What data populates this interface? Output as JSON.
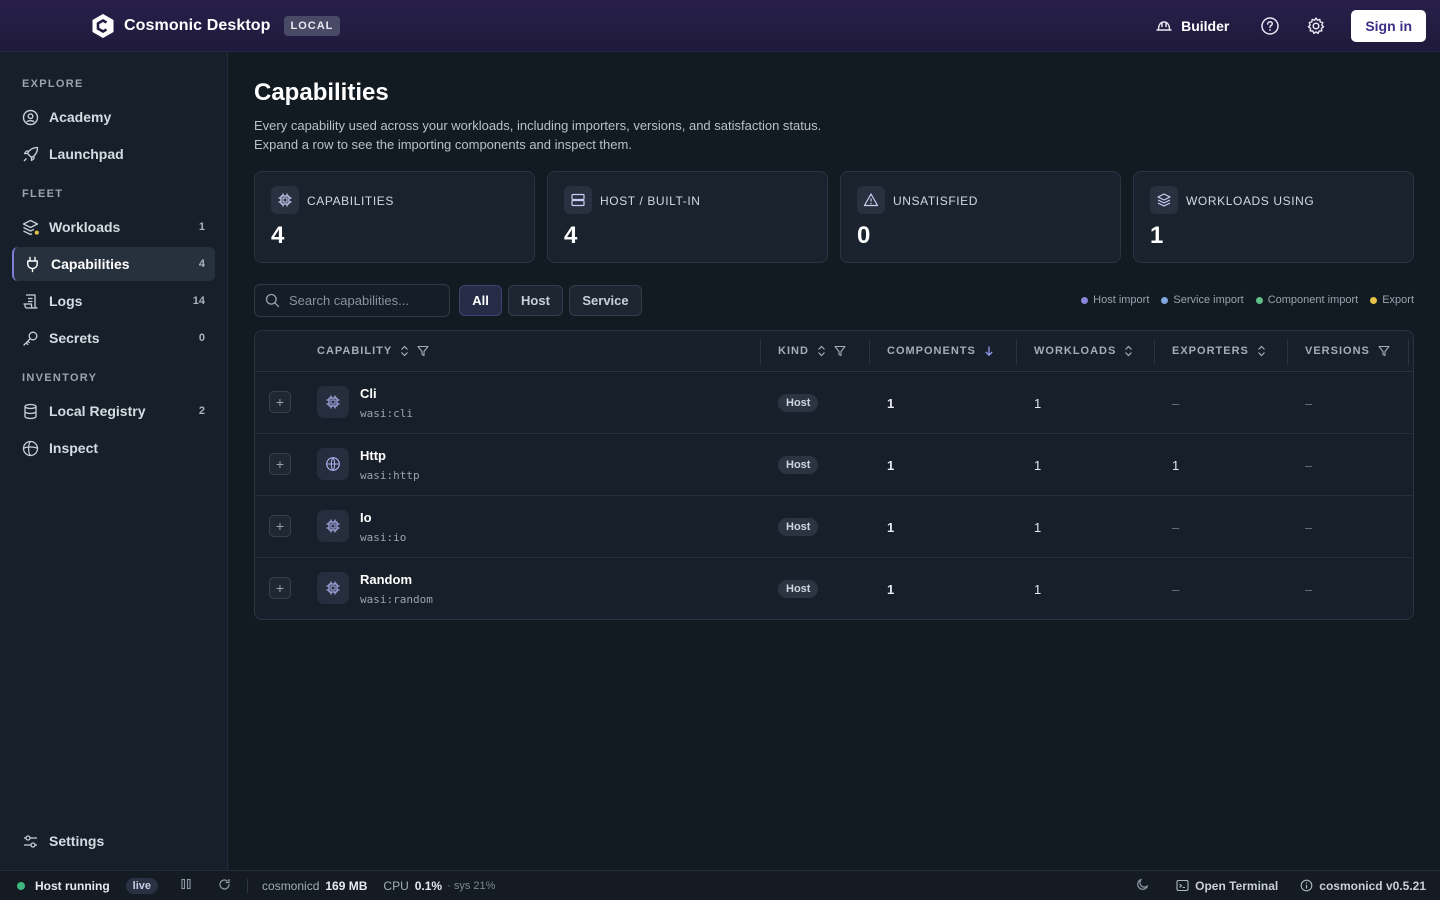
{
  "app": {
    "name": "Cosmonic Desktop",
    "badge": "LOCAL",
    "builder_label": "Builder",
    "signin_label": "Sign in"
  },
  "sidebar": {
    "sections": [
      {
        "title": "EXPLORE"
      },
      {
        "title": "FLEET"
      },
      {
        "title": "INVENTORY"
      }
    ],
    "items": [
      {
        "label": "Academy",
        "count": "",
        "icon": "academy-icon"
      },
      {
        "label": "Launchpad",
        "count": "",
        "icon": "rocket-icon"
      },
      {
        "label": "Workloads",
        "count": "1",
        "icon": "layers-icon"
      },
      {
        "label": "Capabilities",
        "count": "4",
        "icon": "plug-icon",
        "active": true
      },
      {
        "label": "Logs",
        "count": "14",
        "icon": "logs-icon"
      },
      {
        "label": "Secrets",
        "count": "0",
        "icon": "key-icon"
      },
      {
        "label": "Local Registry",
        "count": "2",
        "icon": "database-icon"
      },
      {
        "label": "Inspect",
        "count": "",
        "icon": "inspect-icon"
      },
      {
        "label": "Settings",
        "count": "",
        "icon": "sliders-icon"
      }
    ]
  },
  "page": {
    "title": "Capabilities",
    "description_line1": "Every capability used across your workloads, including importers, versions, and satisfaction status.",
    "description_line2": "Expand a row to see the importing components and inspect them."
  },
  "stats": [
    {
      "label": "CAPABILITIES",
      "value": "4",
      "icon": "chip-icon"
    },
    {
      "label": "HOST / BUILT-IN",
      "value": "4",
      "icon": "server-icon"
    },
    {
      "label": "UNSATISFIED",
      "value": "0",
      "icon": "warning-icon"
    },
    {
      "label": "WORKLOADS USING",
      "value": "1",
      "icon": "layers-icon"
    }
  ],
  "search": {
    "placeholder": "Search capabilities..."
  },
  "filters": [
    {
      "label": "All",
      "active": true
    },
    {
      "label": "Host",
      "active": false
    },
    {
      "label": "Service",
      "active": false
    }
  ],
  "legend": [
    {
      "label": "Host import",
      "color": "#8b86d9"
    },
    {
      "label": "Service import",
      "color": "#7ea6e0"
    },
    {
      "label": "Component import",
      "color": "#5fc08a"
    },
    {
      "label": "Export",
      "color": "#e6c24a"
    }
  ],
  "table": {
    "columns": [
      "CAPABILITY",
      "KIND",
      "COMPONENTS",
      "WORKLOADS",
      "EXPORTERS",
      "VERSIONS"
    ],
    "rows": [
      {
        "name": "Cli",
        "id": "wasi:cli",
        "kind": "Host",
        "components": "1",
        "workloads": "1",
        "exporters": "–",
        "versions": "–",
        "icon": "chip-icon"
      },
      {
        "name": "Http",
        "id": "wasi:http",
        "kind": "Host",
        "components": "1",
        "workloads": "1",
        "exporters": "1",
        "versions": "–",
        "icon": "globe-icon"
      },
      {
        "name": "Io",
        "id": "wasi:io",
        "kind": "Host",
        "components": "1",
        "workloads": "1",
        "exporters": "–",
        "versions": "–",
        "icon": "chip-icon"
      },
      {
        "name": "Random",
        "id": "wasi:random",
        "kind": "Host",
        "components": "1",
        "workloads": "1",
        "exporters": "–",
        "versions": "–",
        "icon": "chip-icon"
      }
    ]
  },
  "statusbar": {
    "host_status": "Host running",
    "live_label": "live",
    "process_name": "cosmonicd",
    "memory": "169 MB",
    "cpu_label": "CPU",
    "cpu_value": "0.1%",
    "sys_value": "· sys 21%",
    "terminal_label": "Open Terminal",
    "version": "cosmonicd v0.5.21"
  }
}
